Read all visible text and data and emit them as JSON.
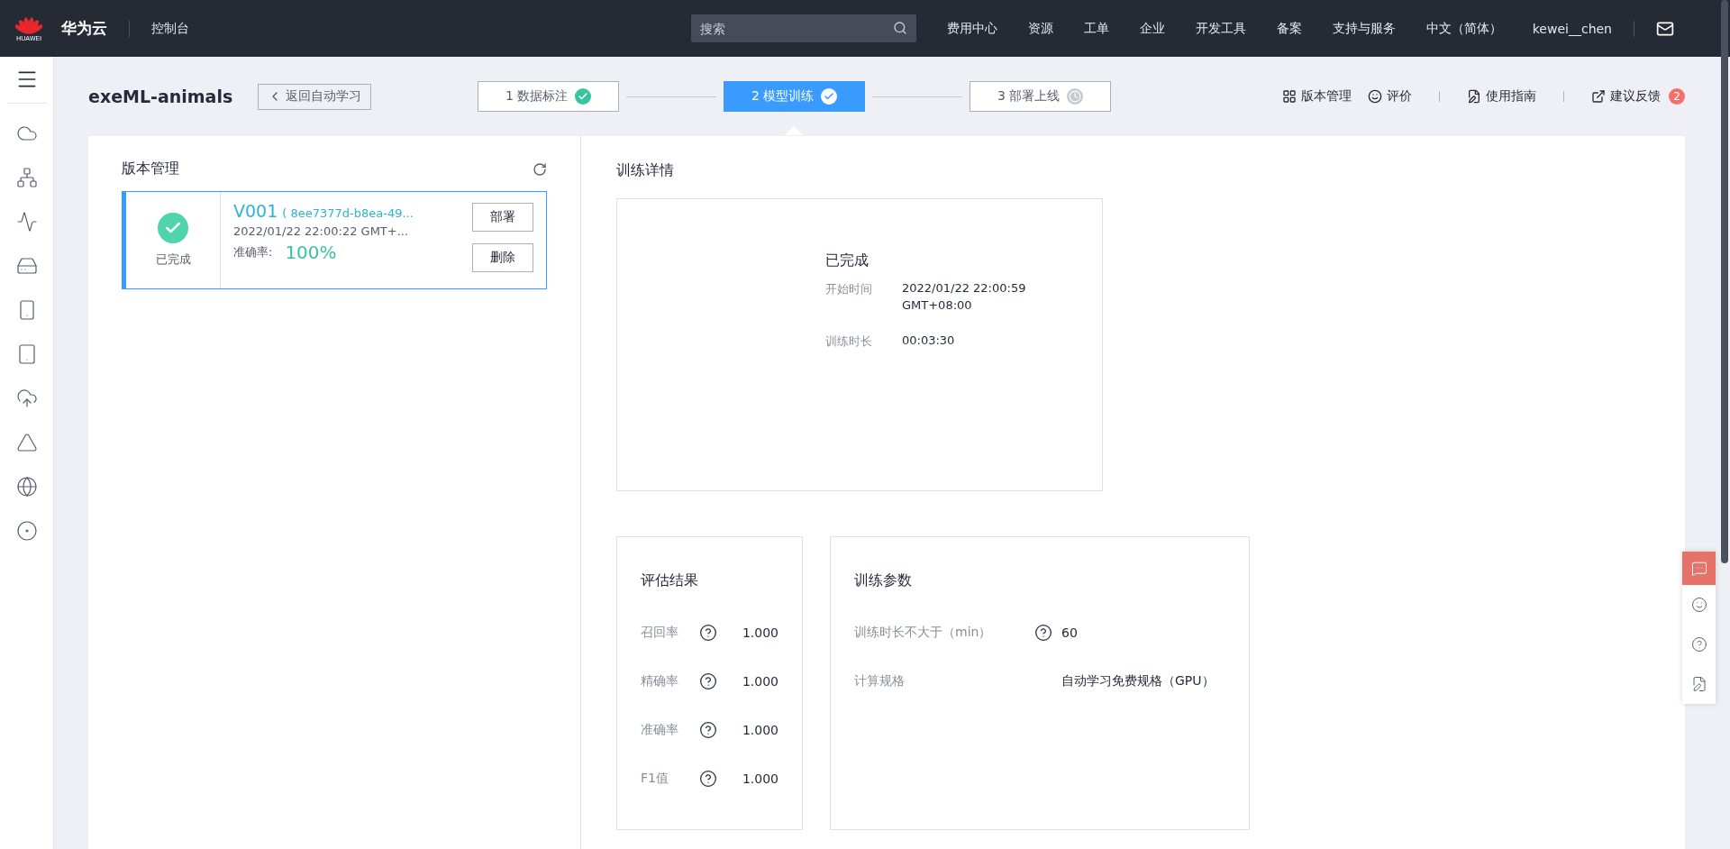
{
  "top_bar": {
    "logo_text": "HUAWEI",
    "brand": "华为云",
    "console": "控制台",
    "search": {
      "placeholder": "搜索"
    },
    "nav": [
      "费用中心",
      "资源",
      "工单",
      "企业",
      "开发工具",
      "备案",
      "支持与服务",
      "中文（简体）",
      "kewei__chen"
    ]
  },
  "header": {
    "title": "exeML-animals",
    "back": "返回自动学习",
    "steps": [
      {
        "label": "1 数据标注",
        "kind": "done",
        "selected": false
      },
      {
        "label": "2 模型训练",
        "kind": "done",
        "selected": true
      },
      {
        "label": "3 部署上线",
        "kind": "pending",
        "selected": false
      }
    ],
    "links": [
      {
        "label": "版本管理"
      },
      {
        "label": "评价"
      },
      {
        "label": "使用指南"
      },
      {
        "label": "建议反馈",
        "badge": "2"
      }
    ]
  },
  "versions": {
    "title": "版本管理",
    "cards": [
      {
        "status": "已完成",
        "done": true,
        "selected": true,
        "name": "V001",
        "id": "( 8ee7377d-b8ea-49...",
        "time": "2022/01/22 22:00:22 GMT+...",
        "accuracy_label": "准确率:",
        "accuracy": "100%",
        "actions": [
          "部署",
          "删除"
        ]
      }
    ]
  },
  "training": {
    "title": "训练详情",
    "status": "已完成",
    "fields": [
      {
        "label": "开始时间",
        "value": [
          "2022/01/22 22:00:59",
          "GMT+08:00"
        ]
      },
      {
        "label": "训练时长",
        "value": [
          "00:03:30"
        ]
      }
    ]
  },
  "evaluation": {
    "title": "评估结果",
    "rows": [
      {
        "label": "召回率",
        "help": true,
        "value": "1.000"
      },
      {
        "label": "精确率",
        "help": true,
        "value": "1.000"
      },
      {
        "label": "准确率",
        "help": true,
        "value": "1.000"
      },
      {
        "label": "F1值",
        "help": true,
        "value": "1.000"
      }
    ]
  },
  "params": {
    "title": "训练参数",
    "rows": [
      {
        "label": "训练时长不大于（min）",
        "help": true,
        "value": "60"
      },
      {
        "label": "计算规格",
        "help": false,
        "value": "自动学习免费规格（GPU）"
      }
    ]
  },
  "float_tools": [
    {
      "selected": true
    },
    {
      "selected": false
    },
    {
      "selected": false
    },
    {
      "selected": false
    }
  ]
}
